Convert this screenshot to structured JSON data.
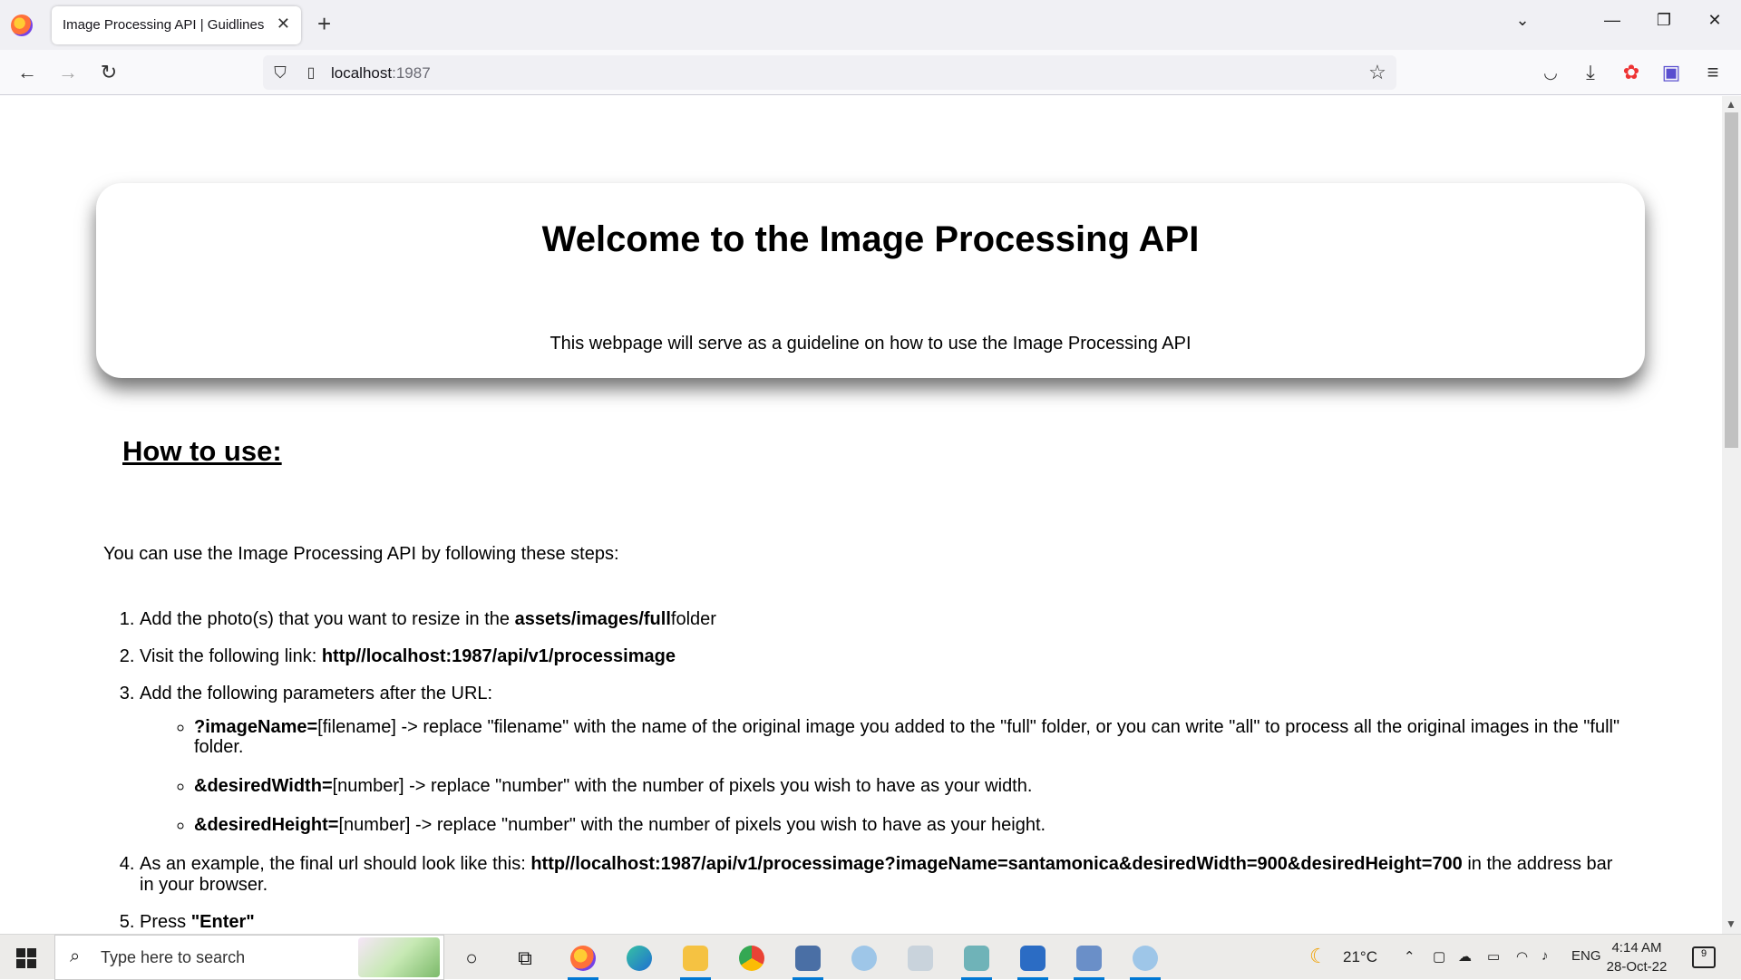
{
  "browser": {
    "tab_title": "Image Processing API | Guidlines",
    "url_host": "localhost",
    "url_port": ":1987"
  },
  "page": {
    "hero_title": "Welcome to the Image Processing API",
    "hero_subtitle": "This webpage will serve as a guideline on how to use the Image Processing API",
    "howto_heading": "How to use:",
    "intro": "You can use the Image Processing API by following these steps:",
    "steps": [
      {
        "pre": "Add the photo(s) that you want to resize in the ",
        "bold": "assets/images/full",
        "post": "folder"
      },
      {
        "pre": "Visit the following link: ",
        "bold": "http//localhost:1987/api/v1/processimage",
        "post": ""
      },
      {
        "pre": "Add the following parameters after the URL:",
        "bold": "",
        "post": ""
      },
      {
        "pre": "As an example, the final url should look like this: ",
        "bold": "http//localhost:1987/api/v1/processimage?imageName=santamonica&desiredWidth=900&desiredHeight=700",
        "post": " in the address bar in your browser."
      },
      {
        "pre": "Press ",
        "bold": "\"Enter\"",
        "post": ""
      }
    ],
    "params": [
      {
        "bold": "?imageName=",
        "text": "[filename] -> replace \"filename\" with the name of the original image you added to the \"full\" folder, or you can write \"all\" to process all the original images in the \"full\" folder."
      },
      {
        "bold": "&desiredWidth=",
        "text": "[number] -> replace \"number\" with the number of pixels you wish to have as your width."
      },
      {
        "bold": "&desiredHeight=",
        "text": "[number] -> replace \"number\" with the number of pixels you wish to have as your height."
      }
    ]
  },
  "taskbar": {
    "search_placeholder": "Type here to search",
    "weather": "21°C",
    "language": "ENG",
    "time": "4:14 AM",
    "date": "28-Oct-22",
    "notifications": "9"
  }
}
